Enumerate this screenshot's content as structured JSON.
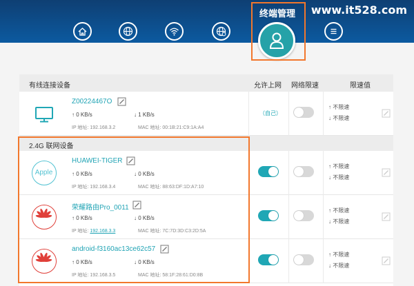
{
  "watermark": "www.it528.com",
  "nav": {
    "active_tab_label": "终端管理",
    "icons": [
      "home-icon",
      "internet-globe-icon",
      "wifi-icon",
      "settings-globe-icon",
      "user-icon",
      "menu-icon"
    ]
  },
  "table_header": {
    "wired_section": "有线连接设备",
    "allow_internet": "允许上网",
    "net_limit": "网络限速",
    "limit_value": "限速值"
  },
  "wired_devices": [
    {
      "name": "Z00224467O",
      "up": "0 KB/s",
      "down": "1 KB/s",
      "ip_label": "IP 地址:",
      "ip": "192.168.3.2",
      "mac_label": "MAC 地址:",
      "mac": "00:1B:21:C9:1A:A4",
      "allow_text": "（自己）",
      "limit_up": "不限速",
      "limit_down": "不限速",
      "icon": "monitor-icon"
    }
  ],
  "wifi_section_title": "2.4G 联网设备",
  "wifi_devices": [
    {
      "name": "HUAWEI-TIGER",
      "up": "0 KB/s",
      "down": "0 KB/s",
      "ip_label": "IP 地址:",
      "ip": "192.168.3.4",
      "mac_label": "MAC 地址:",
      "mac": "88:63:DF:1D:A7:10",
      "limit_up": "不限速",
      "limit_down": "不限速",
      "icon": "apple-logo-icon",
      "logo_text": "Apple",
      "allow_on": true,
      "limit_on": false
    },
    {
      "name": "荣耀路由Pro_0011",
      "up": "0 KB/s",
      "down": "0 KB/s",
      "ip_label": "IP 地址:",
      "ip": "192.168.3.3",
      "mac_label": "MAC 地址:",
      "mac": "7C:7D:3D:C3:2D:5A",
      "limit_up": "不限速",
      "limit_down": "不限速",
      "icon": "huawei-logo-icon",
      "allow_on": true,
      "limit_on": false
    },
    {
      "name": "android-f3160ac13ce62c57",
      "up": "0 KB/s",
      "down": "0 KB/s",
      "ip_label": "IP 地址:",
      "ip": "192.168.3.5",
      "mac_label": "MAC 地址:",
      "mac": "58:1F:28:61:D0:8B",
      "limit_up": "不限速",
      "limit_down": "不限速",
      "icon": "huawei-logo-icon",
      "allow_on": true,
      "limit_on": false
    }
  ],
  "colors": {
    "header_blue": "#0c5aa0",
    "accent_teal": "#20a7b5",
    "highlight_orange": "#f2772c",
    "huawei_red": "#e0403a"
  }
}
